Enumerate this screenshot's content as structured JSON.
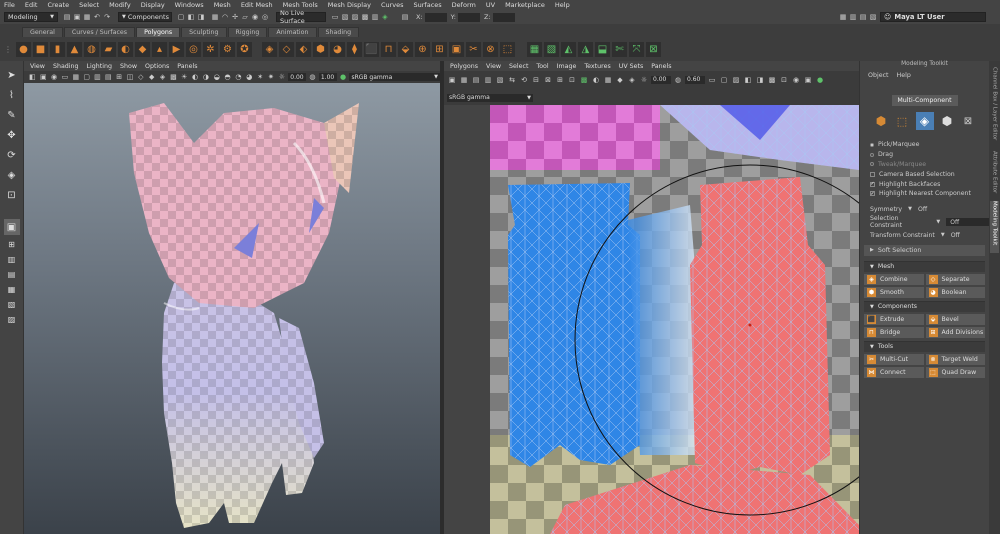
{
  "menubar": [
    "File",
    "Edit",
    "Create",
    "Select",
    "Modify",
    "Display",
    "Windows",
    "Mesh",
    "Edit Mesh",
    "Mesh Tools",
    "Mesh Display",
    "Curves",
    "Surfaces",
    "Deform",
    "UV",
    "Marketplace",
    "Help"
  ],
  "toolbar": {
    "mode_dropdown": "Modeling",
    "components_dropdown": "Components",
    "live_surface": "No Live Surface",
    "x_label": "X:",
    "y_label": "Y:",
    "z_label": "Z:",
    "user": "Maya LT User"
  },
  "shelf_tabs": [
    {
      "label": "General",
      "active": false
    },
    {
      "label": "Curves / Surfaces",
      "active": false
    },
    {
      "label": "Polygons",
      "active": true
    },
    {
      "label": "Sculpting",
      "active": false
    },
    {
      "label": "Rigging",
      "active": false
    },
    {
      "label": "Animation",
      "active": false
    },
    {
      "label": "Shading",
      "active": false
    }
  ],
  "viewport": {
    "menu": [
      "View",
      "Shading",
      "Lighting",
      "Show",
      "Options",
      "Panels"
    ],
    "value_a": "0.00",
    "value_b": "1.00",
    "color_space": "sRGB gamma"
  },
  "uv_editor": {
    "menu": [
      "Polygons",
      "View",
      "Select",
      "Tool",
      "Image",
      "Textures",
      "UV Sets",
      "Panels"
    ],
    "value_a": "0.00",
    "value_b": "0.60",
    "color_space": "sRGB gamma"
  },
  "modeling_toolkit": {
    "title": "Modeling Toolkit",
    "menu": [
      "Object",
      "Help"
    ],
    "multi_component": "Multi-Component",
    "pick_marquee": "Pick/Marquee",
    "drag": "Drag",
    "tweak_marquee": "Tweak/Marquee",
    "camera_based": "Camera Based Selection",
    "highlight_backfaces": "Highlight Backfaces",
    "highlight_nearest": "Highlight Nearest Component",
    "symmetry_label": "Symmetry",
    "symmetry_value": "Off",
    "sel_constraint_label": "Selection Constraint",
    "sel_constraint_value": "Off",
    "transform_constraint_label": "Transform Constraint",
    "transform_constraint_value": "Off",
    "soft_selection": "Soft Selection",
    "sections": {
      "mesh": "Mesh",
      "components": "Components",
      "tools": "Tools"
    },
    "buttons": {
      "combine": "Combine",
      "separate": "Separate",
      "smooth": "Smooth",
      "boolean": "Boolean",
      "extrude": "Extrude",
      "bevel": "Bevel",
      "bridge": "Bridge",
      "add_divisions": "Add Divisions",
      "multi_cut": "Multi-Cut",
      "target_weld": "Target Weld",
      "connect": "Connect",
      "quad_draw": "Quad Draw"
    }
  },
  "side_tabs": [
    "Channel Box / Layer Editor",
    "Attribute Editor",
    "Modeling Toolkit"
  ],
  "colors": {
    "accent_orange": "#d68a35",
    "accent_green": "#5ec26a",
    "uv_blue": "#2f86e6",
    "uv_red": "#ef7373",
    "panel_bg": "#444444"
  }
}
